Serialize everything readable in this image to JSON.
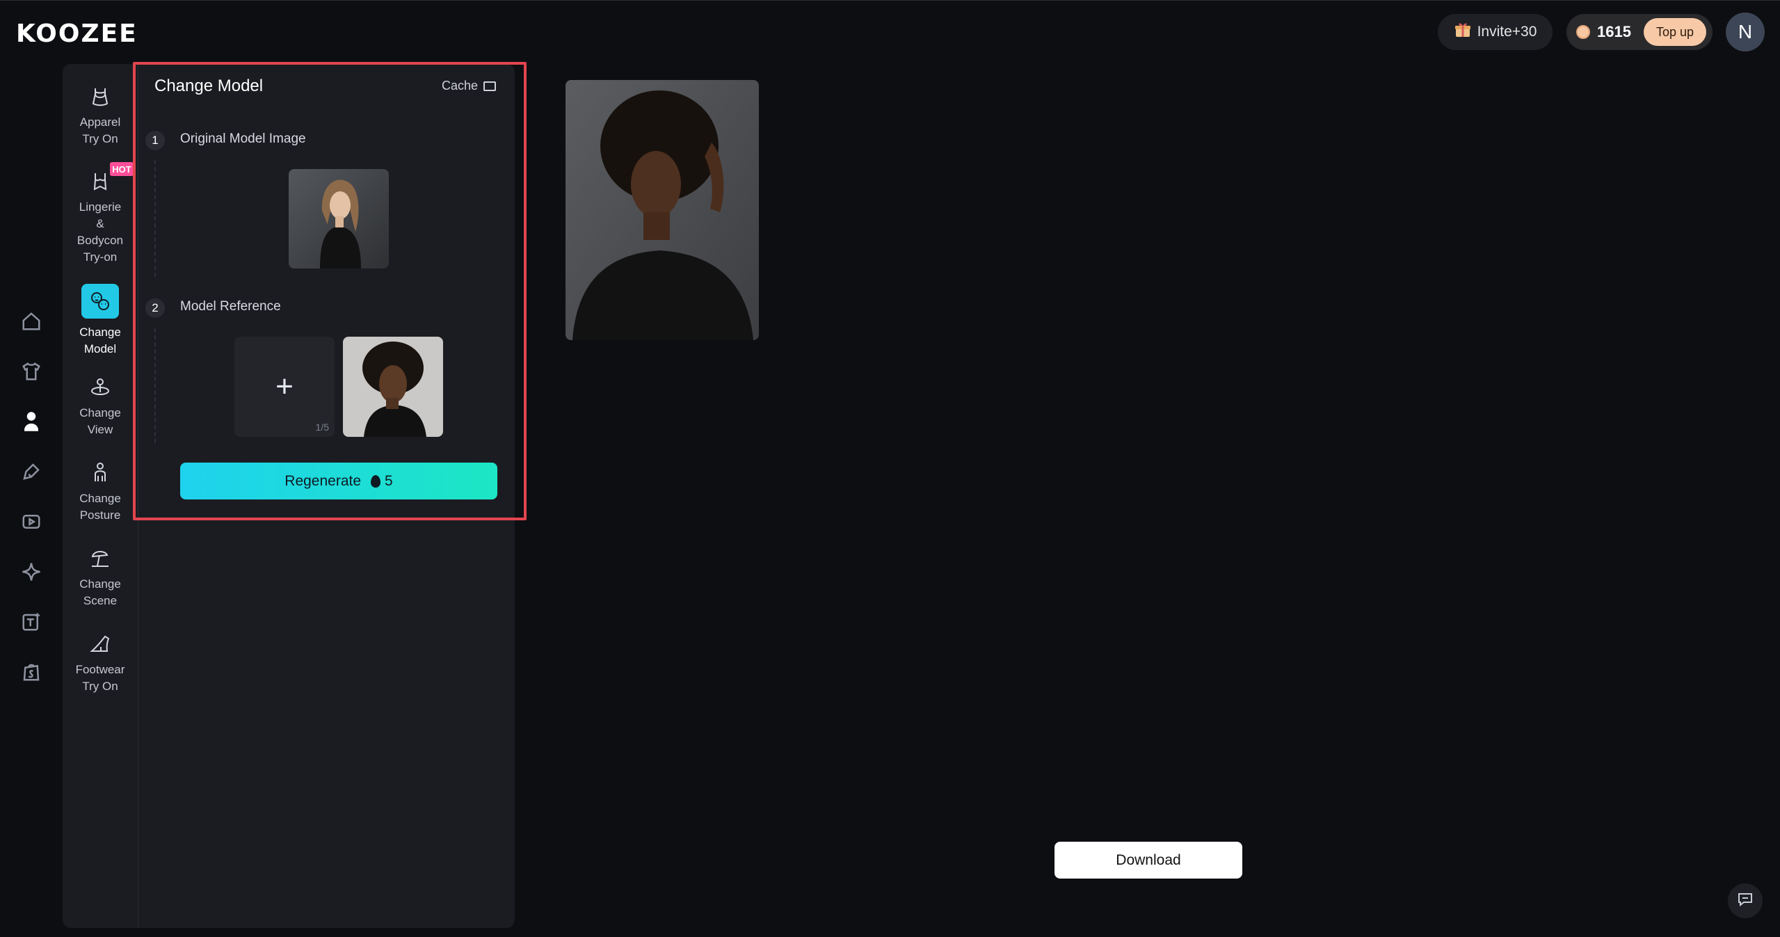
{
  "app": {
    "logo": "KOOZEE",
    "user_initial": "N"
  },
  "header": {
    "invite_label": "Invite+30",
    "credits": "1615",
    "topup_label": "Top up"
  },
  "left_nav": [
    "home-icon",
    "shirt-icon",
    "model-icon",
    "brush-icon",
    "video-icon",
    "sparkle-icon",
    "text-add-icon",
    "shopify-icon"
  ],
  "tools": [
    {
      "label_lines": [
        "Apparel",
        "Try On"
      ],
      "icon": "dress-icon"
    },
    {
      "label_lines": [
        "Lingerie",
        "&",
        "Bodycon",
        "Try-on"
      ],
      "icon": "lingerie-icon",
      "badge": "HOT"
    },
    {
      "label_lines": [
        "Change",
        "Model"
      ],
      "icon": "faces-icon",
      "active": true
    },
    {
      "label_lines": [
        "Change",
        "View"
      ],
      "icon": "rotate-icon"
    },
    {
      "label_lines": [
        "Change",
        "Posture"
      ],
      "icon": "posture-icon"
    },
    {
      "label_lines": [
        "Change",
        "Scene"
      ],
      "icon": "scene-icon"
    },
    {
      "label_lines": [
        "Footwear",
        "Try On"
      ],
      "icon": "heel-icon"
    }
  ],
  "panel": {
    "title": "Change Model",
    "cache_label": "Cache",
    "step1": {
      "num": "1",
      "label": "Original Model Image"
    },
    "step2": {
      "num": "2",
      "label": "Model Reference",
      "count": "1/5"
    },
    "regenerate_label": "Regenerate",
    "cost": "5"
  },
  "download_label": "Download",
  "colors": {
    "accent_cyan": "#22c9e6",
    "highlight_red": "#e2454e",
    "hot_pink": "#ff4f9a",
    "topup": "#f7c9a6"
  }
}
